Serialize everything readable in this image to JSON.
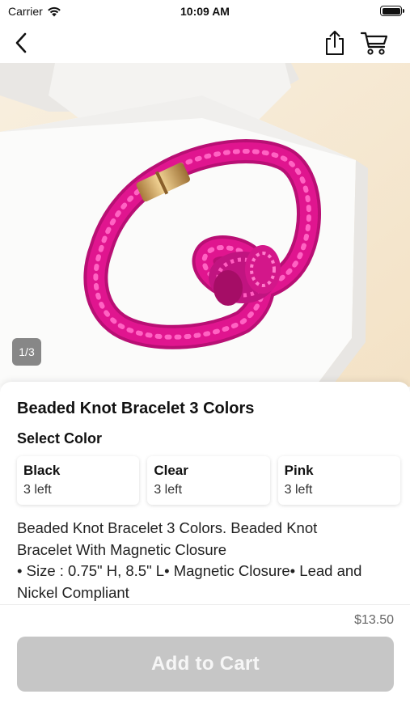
{
  "status_bar": {
    "carrier": "Carrier",
    "time": "10:09 AM"
  },
  "nav": {
    "back_icon": "chevron-left-icon",
    "share_icon": "share-icon",
    "cart_icon": "cart-icon"
  },
  "gallery": {
    "page_indicator": "1/3"
  },
  "product": {
    "title": "Beaded Knot Bracelet 3 Colors",
    "select_color_label": "Select Color",
    "variants": [
      {
        "name": "Black",
        "stock": "3 left"
      },
      {
        "name": "Clear",
        "stock": "3 left"
      },
      {
        "name": "Pink",
        "stock": "3 left"
      }
    ],
    "description_lines": [
      "Beaded Knot Bracelet 3 Colors. Beaded Knot",
      "Bracelet With Magnetic Closure",
      "• Size : 0.75\" H, 8.5\" L• Magnetic Closure• Lead and",
      "Nickel Compliant"
    ],
    "price": "$13.50",
    "add_to_cart_label": "Add to Cart"
  },
  "colors": {
    "bracelet": "#e0158f",
    "button_disabled": "#c6c6c6",
    "background": "#ffffff"
  }
}
